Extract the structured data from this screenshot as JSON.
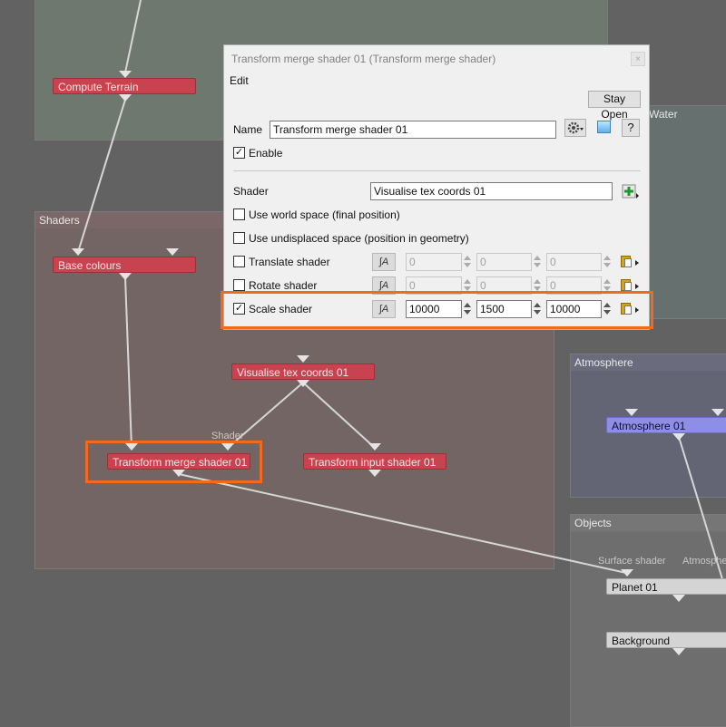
{
  "graph": {
    "groups": {
      "top": "",
      "shaders": "Shaders",
      "water": "Water",
      "atmosphere": "Atmosphere",
      "objects": "Objects"
    },
    "nodes": {
      "compute_terrain": "Compute Terrain",
      "base_colours": "Base colours",
      "visualise_tex_coords": "Visualise tex coords 01",
      "transform_merge": "Transform merge shader 01",
      "transform_input": "Transform input shader 01",
      "atmosphere_01": "Atmosphere 01",
      "planet_01": "Planet 01",
      "background": "Background"
    },
    "port_labels": {
      "shader": "Shader",
      "surface_shader": "Surface shader",
      "atmosphere_cut": "Atmosphe"
    }
  },
  "dialog": {
    "title": "Transform merge shader 01    (Transform merge shader)",
    "close_glyph": "×",
    "menu_edit": "Edit",
    "stay_open": "Stay Open",
    "name_label": "Name",
    "name_value": "Transform merge shader 01",
    "help_label": "?",
    "enable_label": "Enable",
    "enable_checked": true,
    "shader_label": "Shader",
    "shader_value": "Visualise tex coords 01",
    "world_space_label": "Use world space (final position)",
    "undisplaced_label": "Use undisplaced space (position in geometry)",
    "anim_glyph": "∫A",
    "translate": {
      "label": "Translate shader",
      "checked": false,
      "x": "0",
      "y": "0",
      "z": "0"
    },
    "rotate": {
      "label": "Rotate shader",
      "checked": false,
      "x": "0",
      "y": "0",
      "z": "0"
    },
    "scale": {
      "label": "Scale shader",
      "checked": true,
      "x": "10000",
      "y": "1500",
      "z": "10000"
    }
  },
  "colors": {
    "highlight": "#f26a1c",
    "node_red": "#c8434f",
    "node_blue": "#8e8ee6",
    "node_gray": "#d4d4d4"
  }
}
